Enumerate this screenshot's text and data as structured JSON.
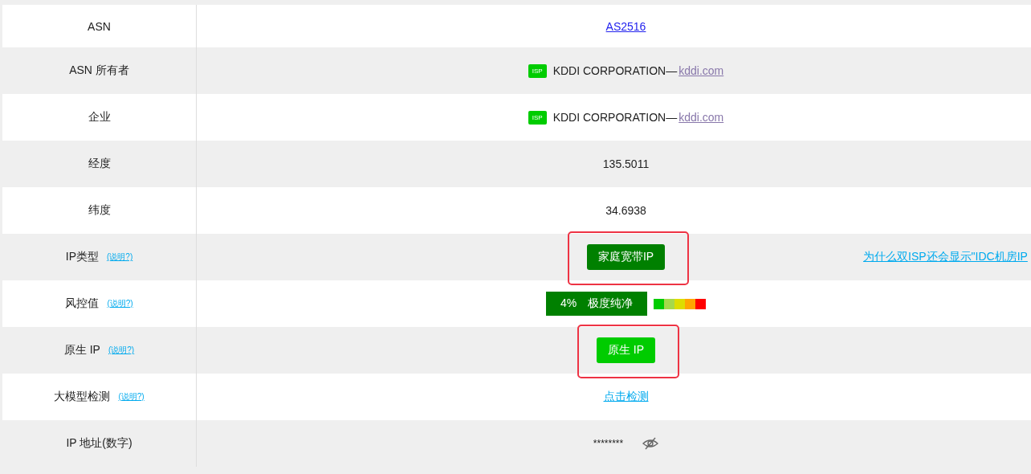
{
  "rows": [
    {
      "label": "ASN",
      "value": {
        "kind": "link",
        "text": "AS2516"
      }
    },
    {
      "label": "ASN 所有者",
      "value": {
        "kind": "isp",
        "tag": "ISP",
        "text": "KDDI CORPORATION—",
        "link": "kddi.com"
      }
    },
    {
      "label": "企业",
      "value": {
        "kind": "isp",
        "tag": "ISP",
        "text": "KDDI CORPORATION—",
        "link": "kddi.com"
      }
    },
    {
      "label": "经度",
      "value": {
        "kind": "text",
        "text": "135.5011"
      }
    },
    {
      "label": "纬度",
      "value": {
        "kind": "text",
        "text": "34.6938"
      }
    },
    {
      "label": "IP类型",
      "help": "(说明?)",
      "value": {
        "kind": "badge",
        "text": "家庭宽带IP",
        "color": "#008000",
        "highlighted": true,
        "note": "为什么双ISP还会显示\"IDC机房IP"
      }
    },
    {
      "label": "风控值",
      "help": "(说明?)",
      "value": {
        "kind": "risk",
        "score": "4%",
        "text": "极度纯净",
        "scale": [
          {
            "color": "#00cc00"
          },
          {
            "color": "#a6d94a"
          },
          {
            "color": "#dddd00"
          },
          {
            "color": "#ffa500"
          },
          {
            "color": "#ff0000"
          }
        ]
      }
    },
    {
      "label": "原生 IP",
      "help": "(说明?)",
      "value": {
        "kind": "badge",
        "text": "原生 IP",
        "color": "#00cc00",
        "highlighted": true
      }
    },
    {
      "label": "大模型检测",
      "help": "(说明?)",
      "value": {
        "kind": "action",
        "text": "点击检测"
      }
    },
    {
      "label": "IP 地址(数字)",
      "value": {
        "kind": "masked",
        "text": "********"
      }
    }
  ]
}
